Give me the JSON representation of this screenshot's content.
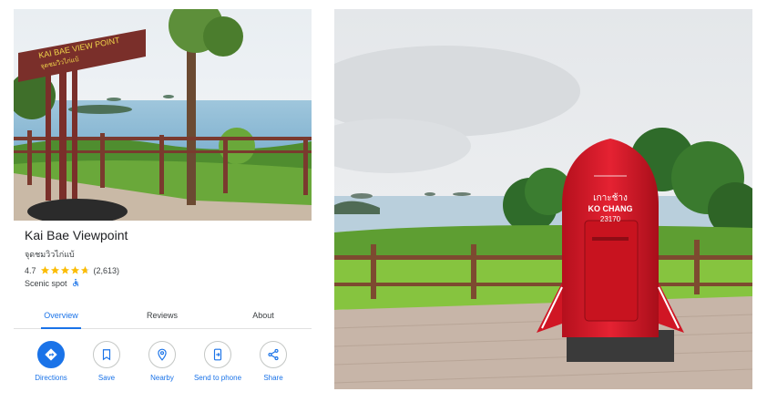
{
  "place": {
    "name": "Kai Bae Viewpoint",
    "local_name": "จุดชมวิวไก่แบ้",
    "rating": "4.7",
    "stars": 4.7,
    "review_count": "(2,613)",
    "category": "Scenic spot"
  },
  "photos": {
    "left_sign_line1": "KAI BAE VIEW POINT",
    "left_sign_line2": "จุดชมวิวไก่แบ้",
    "mailbox_line1": "เกาะช้าง",
    "mailbox_line2": "KO CHANG",
    "mailbox_line3": "23170"
  },
  "tabs": [
    {
      "label": "Overview",
      "active": true
    },
    {
      "label": "Reviews",
      "active": false
    },
    {
      "label": "About",
      "active": false
    }
  ],
  "actions": [
    {
      "label": "Directions",
      "icon": "directions-icon"
    },
    {
      "label": "Save",
      "icon": "bookmark-icon"
    },
    {
      "label": "Nearby",
      "icon": "nearby-icon"
    },
    {
      "label": "Send to phone",
      "icon": "send-to-phone-icon"
    },
    {
      "label": "Share",
      "icon": "share-icon"
    }
  ],
  "colors": {
    "accent": "#1a73e8",
    "star": "#fbbc04",
    "mailbox_red": "#d9172a"
  }
}
